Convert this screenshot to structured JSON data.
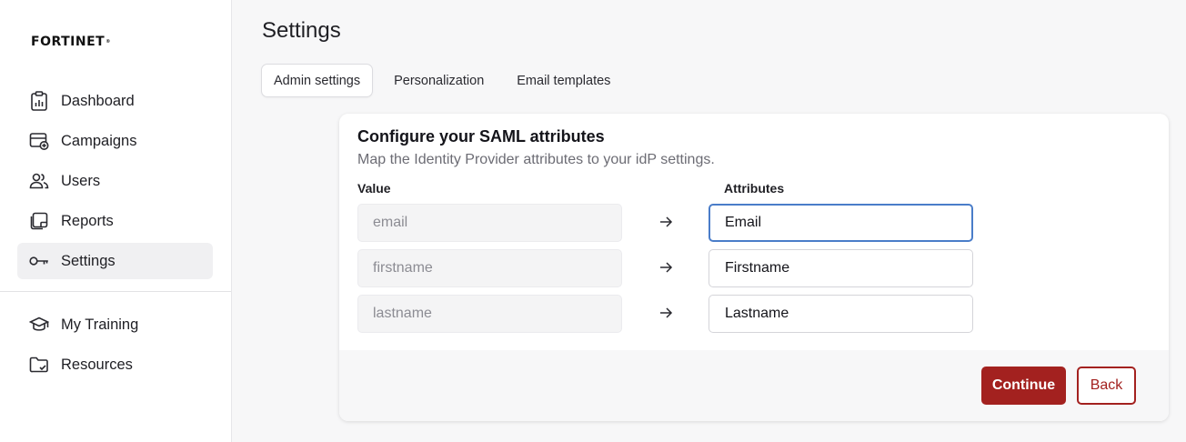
{
  "brand": {
    "logo_text": "FORTINET",
    "accent": "#a3211f"
  },
  "sidebar": {
    "items": [
      {
        "label": "Dashboard",
        "icon": "clipboard-chart-icon"
      },
      {
        "label": "Campaigns",
        "icon": "calendar-plus-icon"
      },
      {
        "label": "Users",
        "icon": "users-icon"
      },
      {
        "label": "Reports",
        "icon": "report-note-icon"
      },
      {
        "label": "Settings",
        "icon": "key-icon",
        "active": true
      }
    ],
    "secondary_items": [
      {
        "label": "My Training",
        "icon": "graduation-cap-icon"
      },
      {
        "label": "Resources",
        "icon": "folder-check-icon"
      }
    ]
  },
  "page": {
    "title": "Settings"
  },
  "tabs": [
    {
      "label": "Admin settings",
      "active": true
    },
    {
      "label": "Personalization"
    },
    {
      "label": "Email templates"
    }
  ],
  "card": {
    "title": "Configure your SAML attributes",
    "subtitle": "Map the Identity Provider attributes to your idP settings.",
    "value_header": "Value",
    "attributes_header": "Attributes",
    "rows": [
      {
        "value": "email",
        "attribute": "Email"
      },
      {
        "value": "firstname",
        "attribute": "Firstname"
      },
      {
        "value": "lastname",
        "attribute": "Lastname"
      }
    ],
    "continue_label": "Continue",
    "back_label": "Back"
  }
}
